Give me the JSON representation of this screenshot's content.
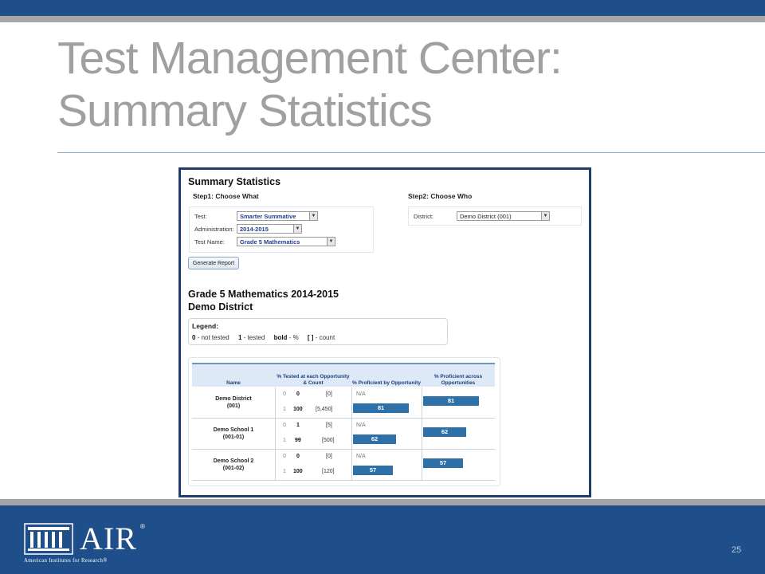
{
  "slide": {
    "title_line1": "Test Management Center:",
    "title_line2": "Summary Statistics",
    "page_number": "25"
  },
  "footer": {
    "logo_text": "AIR",
    "logo_registered": "®",
    "logo_subtitle": "American Institutes for Research®"
  },
  "colors": {
    "brand_blue": "#1f4f8a",
    "rule_gray": "#a6a6a6",
    "bar_blue": "#2e70a8"
  },
  "app": {
    "title": "Summary Statistics",
    "step1_title": "Step1: Choose What",
    "step2_title": "Step2: Choose Who",
    "test_label": "Test:",
    "test_value": "Smarter Summative",
    "administration_label": "Administration:",
    "administration_value": "2014-2015",
    "test_name_label": "Test Name:",
    "test_name_value": "Grade 5 Mathematics",
    "district_label": "District:",
    "district_value": "Demo District (001)",
    "generate_button": "Generate Report",
    "report_title": "Grade 5 Mathematics 2014-2015",
    "report_subtitle": "Demo District"
  },
  "legend": {
    "title": "Legend:",
    "k0": "0",
    "v0": "- not tested",
    "k1": "1",
    "v1": "- tested",
    "kbold": "bold",
    "vbold": "- %",
    "kcount": "[ ]",
    "vcount": "- count"
  },
  "table": {
    "headers": {
      "name": "Name",
      "tested": "% Tested at each Opportunity & Count",
      "proficient_opp": "% Proficient by Opportunity",
      "proficient_across": "% Proficient across Opportunities"
    },
    "rows": [
      {
        "name": "Demo District",
        "code": "(001)",
        "opp0": "0",
        "pct0": "0",
        "count0": "[0]",
        "prof0": "N/A",
        "opp1": "1",
        "pct1": "100",
        "count1": "[5,450]",
        "prof1": "81",
        "across": "81"
      },
      {
        "name": "Demo School 1",
        "code": "(001-01)",
        "opp0": "0",
        "pct0": "1",
        "count0": "[5]",
        "prof0": "N/A",
        "opp1": "1",
        "pct1": "99",
        "count1": "[500]",
        "prof1": "62",
        "across": "62"
      },
      {
        "name": "Demo School 2",
        "code": "(001-02)",
        "opp0": "0",
        "pct0": "0",
        "count0": "[0]",
        "prof0": "N/A",
        "opp1": "1",
        "pct1": "100",
        "count1": "[120]",
        "prof1": "57",
        "across": "57"
      }
    ]
  }
}
